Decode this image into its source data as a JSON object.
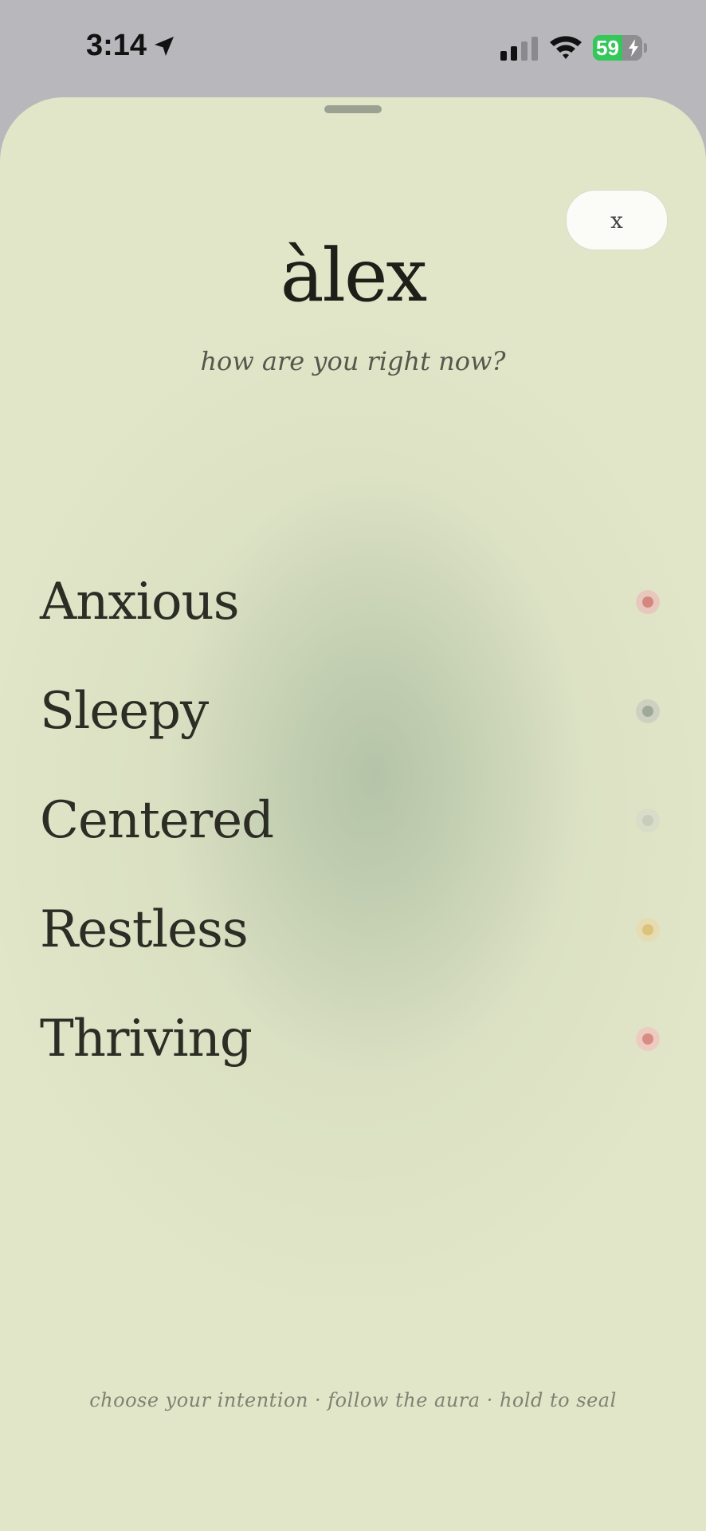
{
  "status_bar": {
    "time": "3:14",
    "battery_percent": 59,
    "battery_label": "59"
  },
  "sheet": {
    "close_label": "x",
    "title": "àlex",
    "subtitle": "how are you right now?",
    "moods": [
      {
        "label": "Anxious",
        "dot_color": "#d4877e",
        "ring_color": "#e8c8bc"
      },
      {
        "label": "Sleepy",
        "dot_color": "#a0a898",
        "ring_color": "#cdd2c0"
      },
      {
        "label": "Centered",
        "dot_color": "#c8cdbb",
        "ring_color": "#d8dcc8"
      },
      {
        "label": "Restless",
        "dot_color": "#dcc27a",
        "ring_color": "#e6dcb4"
      },
      {
        "label": "Thriving",
        "dot_color": "#d98c84",
        "ring_color": "#ecccc0"
      }
    ],
    "footer": "choose your intention · follow the aura · hold to seal"
  },
  "colors": {
    "sheet_bg": "#e2e6c8",
    "accent_text": "#2c2d25",
    "battery_green": "#34c759"
  }
}
